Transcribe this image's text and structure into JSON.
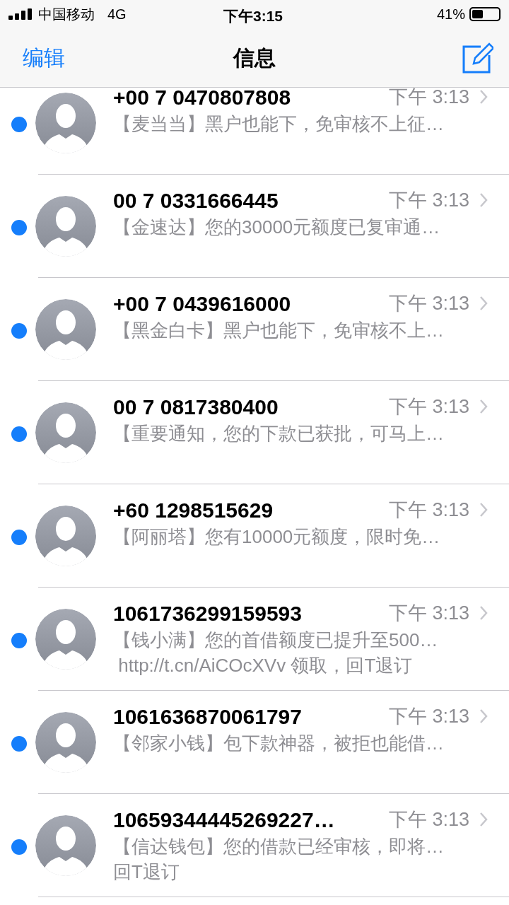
{
  "status_bar": {
    "carrier": "中国移动",
    "network": "4G",
    "time": "下午3:15",
    "battery": "41%"
  },
  "nav_bar": {
    "left": "编辑",
    "title": "信息"
  },
  "conversations": [
    {
      "sender": "+00 7 0470807808",
      "time": "下午 3:13",
      "unread": true,
      "preview": [
        "【麦当当】黑户也能下，免审核不上征…"
      ]
    },
    {
      "sender": "00 7 0331666445",
      "time": "下午 3:13",
      "unread": true,
      "preview": [
        "【金速达】您的30000元额度已复审通…"
      ]
    },
    {
      "sender": "+00 7 0439616000",
      "time": "下午 3:13",
      "unread": true,
      "preview": [
        "【黑金白卡】黑户也能下，免审核不上…"
      ]
    },
    {
      "sender": "00 7 0817380400",
      "time": "下午 3:13",
      "unread": true,
      "preview": [
        "【重要通知，您的下款已获批，可马上…"
      ]
    },
    {
      "sender": "+60 1298515629",
      "time": "下午 3:13",
      "unread": true,
      "preview": [
        "【阿丽塔】您有10000元额度，限时免…"
      ]
    },
    {
      "sender": "1061736299159593",
      "time": "下午 3:13",
      "unread": true,
      "preview": [
        "【钱小满】您的首借额度已提升至500…",
        " http://t.cn/AiCOcXVv 领取，回T退订"
      ]
    },
    {
      "sender": "1061636870061797",
      "time": "下午 3:13",
      "unread": true,
      "preview": [
        "【邻家小钱】包下款神器，被拒也能借…"
      ]
    },
    {
      "sender": "10659344445269227…",
      "time": "下午 3:13",
      "unread": true,
      "preview": [
        "【信达钱包】您的借款已经审核，即将…",
        "回T退订"
      ]
    }
  ]
}
